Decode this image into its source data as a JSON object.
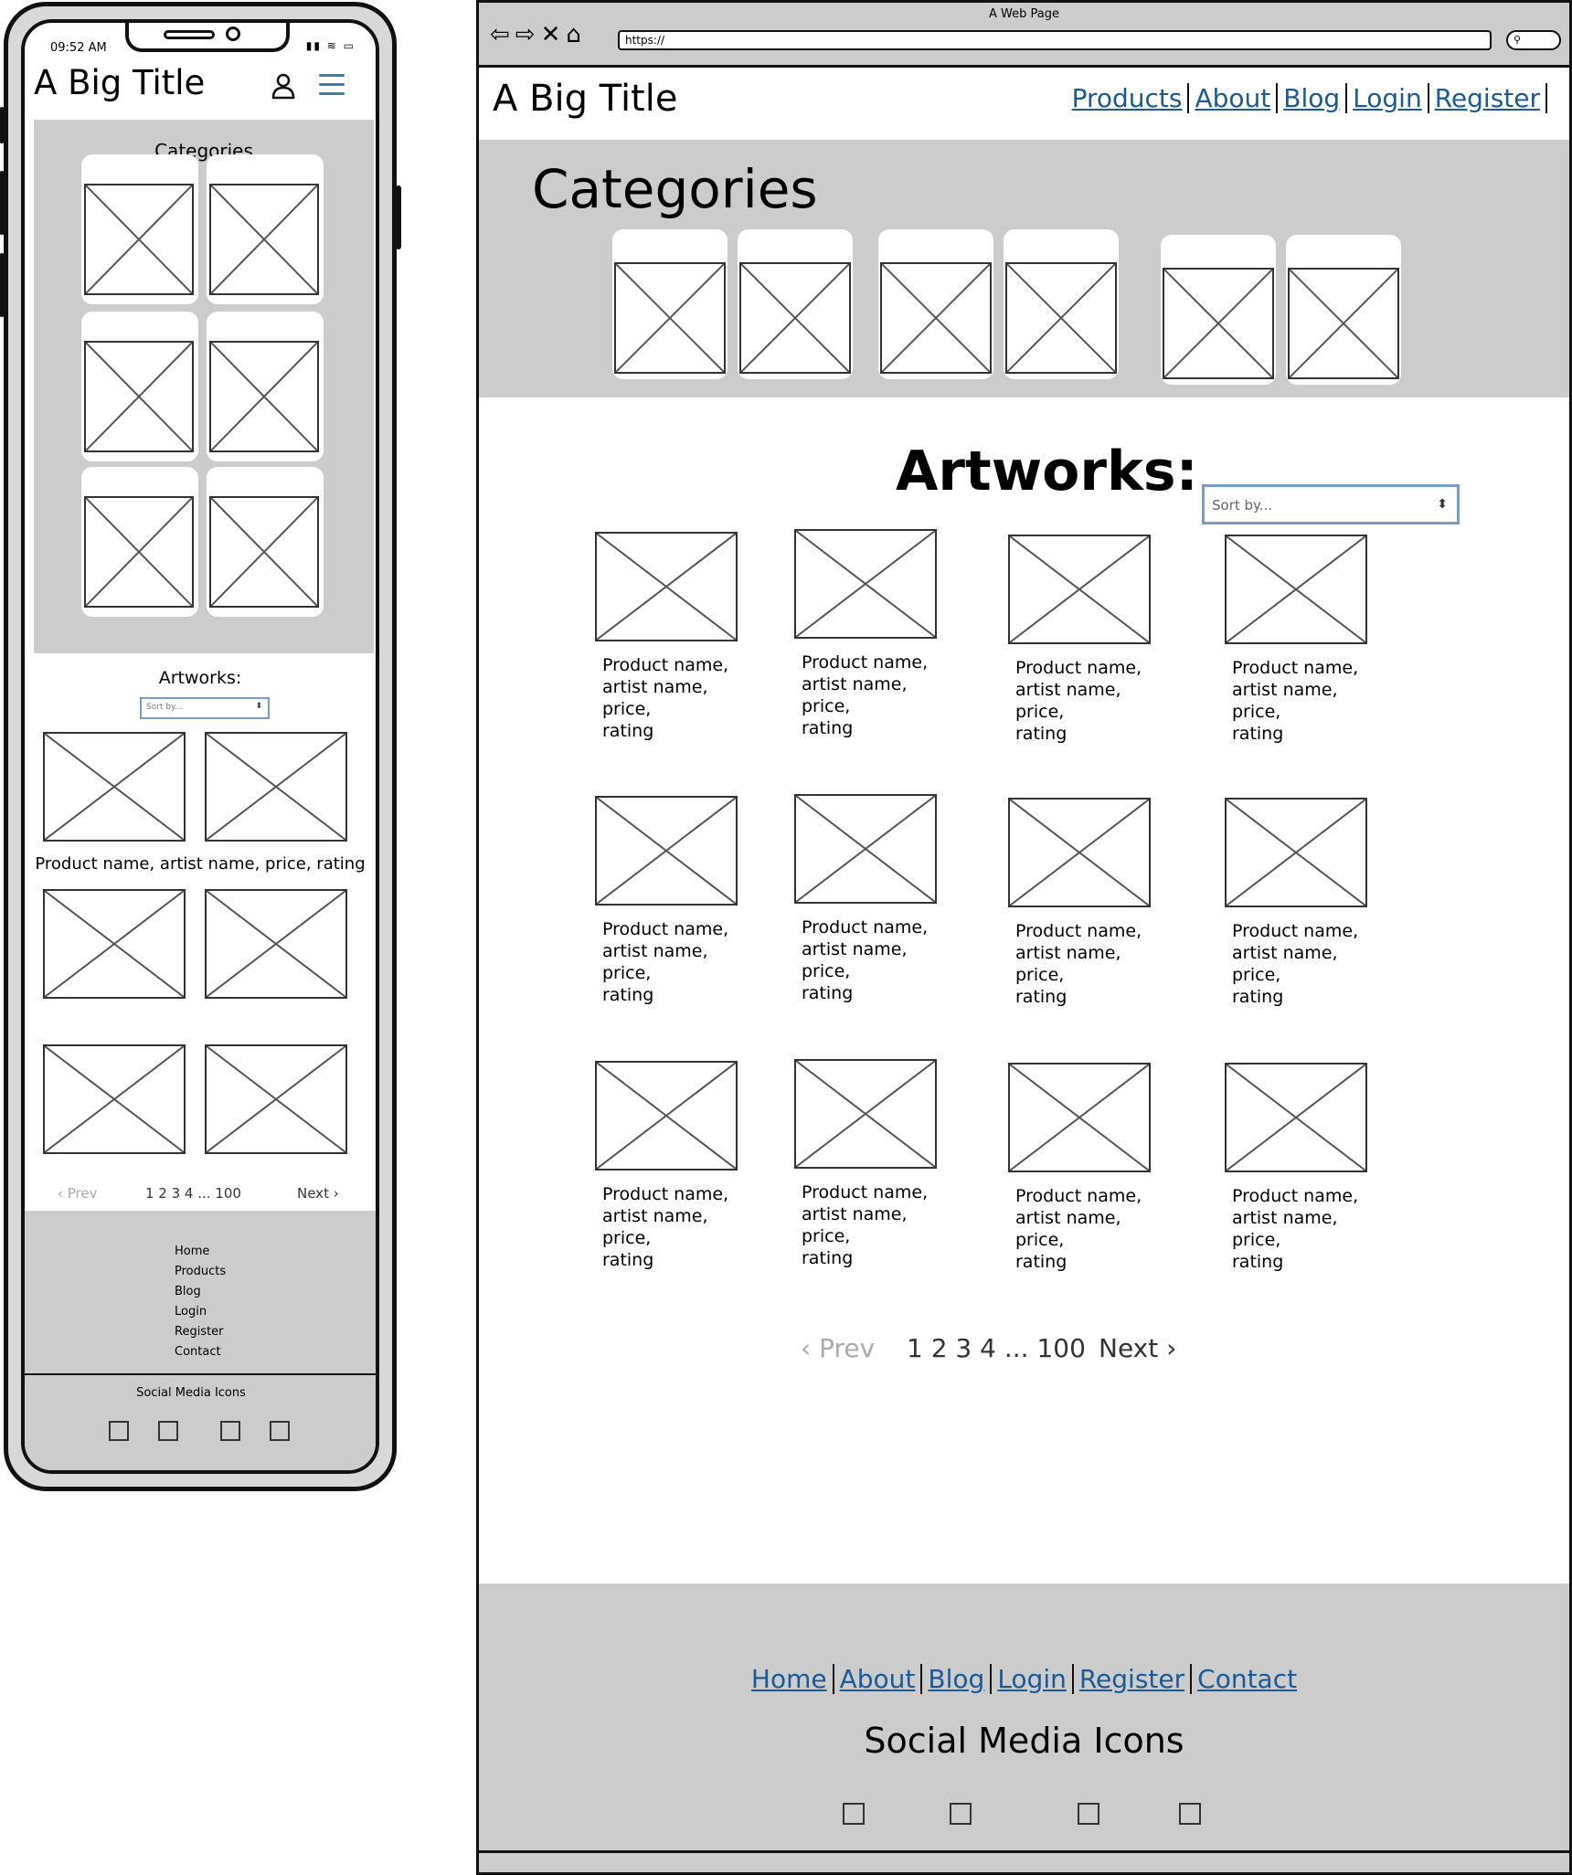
{
  "mobile": {
    "status_time": "09:52 AM",
    "title": "A Big Title",
    "user_icon": "user-icon",
    "menu_icon": "hamburger-icon",
    "categories_title": "Categories",
    "artworks_title": "Artworks:",
    "sort_placeholder": "Sort by...",
    "product_caption": "Product name, artist name, price, rating",
    "pagination": {
      "prev": "‹ Prev",
      "pages": "1 2 3 4 ... 100",
      "next": "Next ›"
    },
    "footer_links": [
      "Home",
      "Products",
      "Blog",
      "Login",
      "Register",
      "Contact"
    ],
    "social_title": "Social Media Icons"
  },
  "browser": {
    "window_title": "A Web Page",
    "url": "https://",
    "title": "A Big Title",
    "nav": [
      "Products",
      "About",
      "Blog",
      "Login",
      "Register"
    ],
    "categories_title": "Categories",
    "artworks_title": "Artworks:",
    "sort_placeholder": "Sort by...",
    "product_caption": [
      "Product name,",
      "artist name,",
      "price,",
      "rating"
    ],
    "pagination": {
      "prev": "‹ Prev",
      "pages": "1 2 3 4 ... 100",
      "next": "Next ›"
    },
    "footer_links": [
      "Home",
      "About",
      "Blog",
      "Login",
      "Register",
      "Contact"
    ],
    "social_title": "Social Media Icons"
  },
  "colors": {
    "panel": "#cccccc",
    "link": "#1a5a96",
    "accent": "#3a7fa8"
  }
}
